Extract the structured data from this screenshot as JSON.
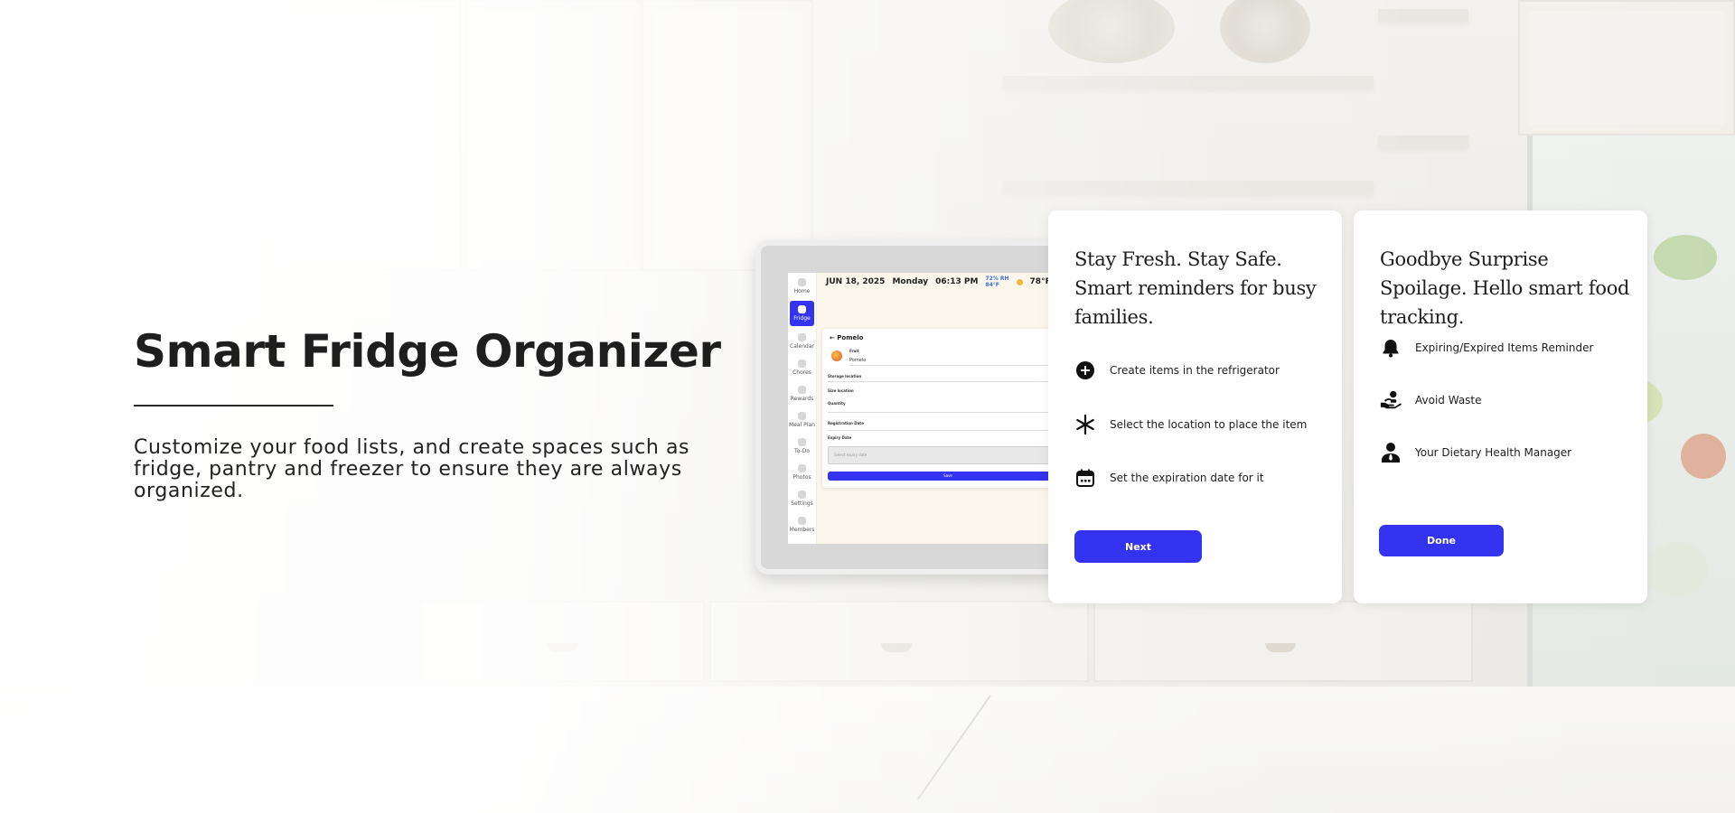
{
  "hero": {
    "title": "Smart Fridge Organizer",
    "description": "Customize your food lists, and create spaces such as fridge, pantry and freezer to ensure they are always organized."
  },
  "tablet": {
    "date": "JUN 18, 2025",
    "day": "Monday",
    "time": "06:13 PM",
    "weather_small": "72% RH",
    "weather_small2": "84°F",
    "temperature": "78°F",
    "sidebar": [
      {
        "label": "Home",
        "icon": "home-icon"
      },
      {
        "label": "Fridge",
        "icon": "fridge-icon",
        "active": true
      },
      {
        "label": "Calendar",
        "icon": "calendar-icon"
      },
      {
        "label": "Chores",
        "icon": "chores-icon"
      },
      {
        "label": "Rewards",
        "icon": "rewards-icon"
      },
      {
        "label": "Meal Plan",
        "icon": "meal-plan-icon"
      },
      {
        "label": "To-Do",
        "icon": "todo-icon"
      },
      {
        "label": "Photos",
        "icon": "photos-icon"
      },
      {
        "label": "Settings",
        "icon": "settings-icon"
      },
      {
        "label": "Members",
        "icon": "members-icon"
      }
    ],
    "panel": {
      "title": "← Pomelo",
      "name_label": "Fruit",
      "name_value": "Pomelo",
      "storage_label": "Storage location",
      "size_label": "Size location",
      "quantity_label": "Quantity",
      "registration_label": "Registration Date",
      "expiry_label": "Expiry Date",
      "expiry_placeholder": "Select expiry date",
      "save_label": "Save"
    }
  },
  "card1": {
    "heading": "Stay Fresh. Stay Safe. Smart reminders for busy families.",
    "features": [
      {
        "label": "Create items in the refrigerator",
        "icon": "plus-circle-icon"
      },
      {
        "label": "Select the location to place the item",
        "icon": "snowflake-icon"
      },
      {
        "label": "Set the expiration date for it",
        "icon": "calendar-icon"
      }
    ],
    "button": "Next"
  },
  "card2": {
    "heading": "Goodbye Surprise Spoilage. Hello smart food tracking.",
    "features": [
      {
        "label": "Expiring/Expired Items Reminder",
        "icon": "bell-icon"
      },
      {
        "label": "Avoid Waste",
        "icon": "hand-heart-icon"
      },
      {
        "label": "Your Dietary Health Manager",
        "icon": "user-tie-icon"
      }
    ],
    "button": "Done"
  },
  "colors": {
    "accent": "#3434F0",
    "text": "#1D1D1D"
  }
}
